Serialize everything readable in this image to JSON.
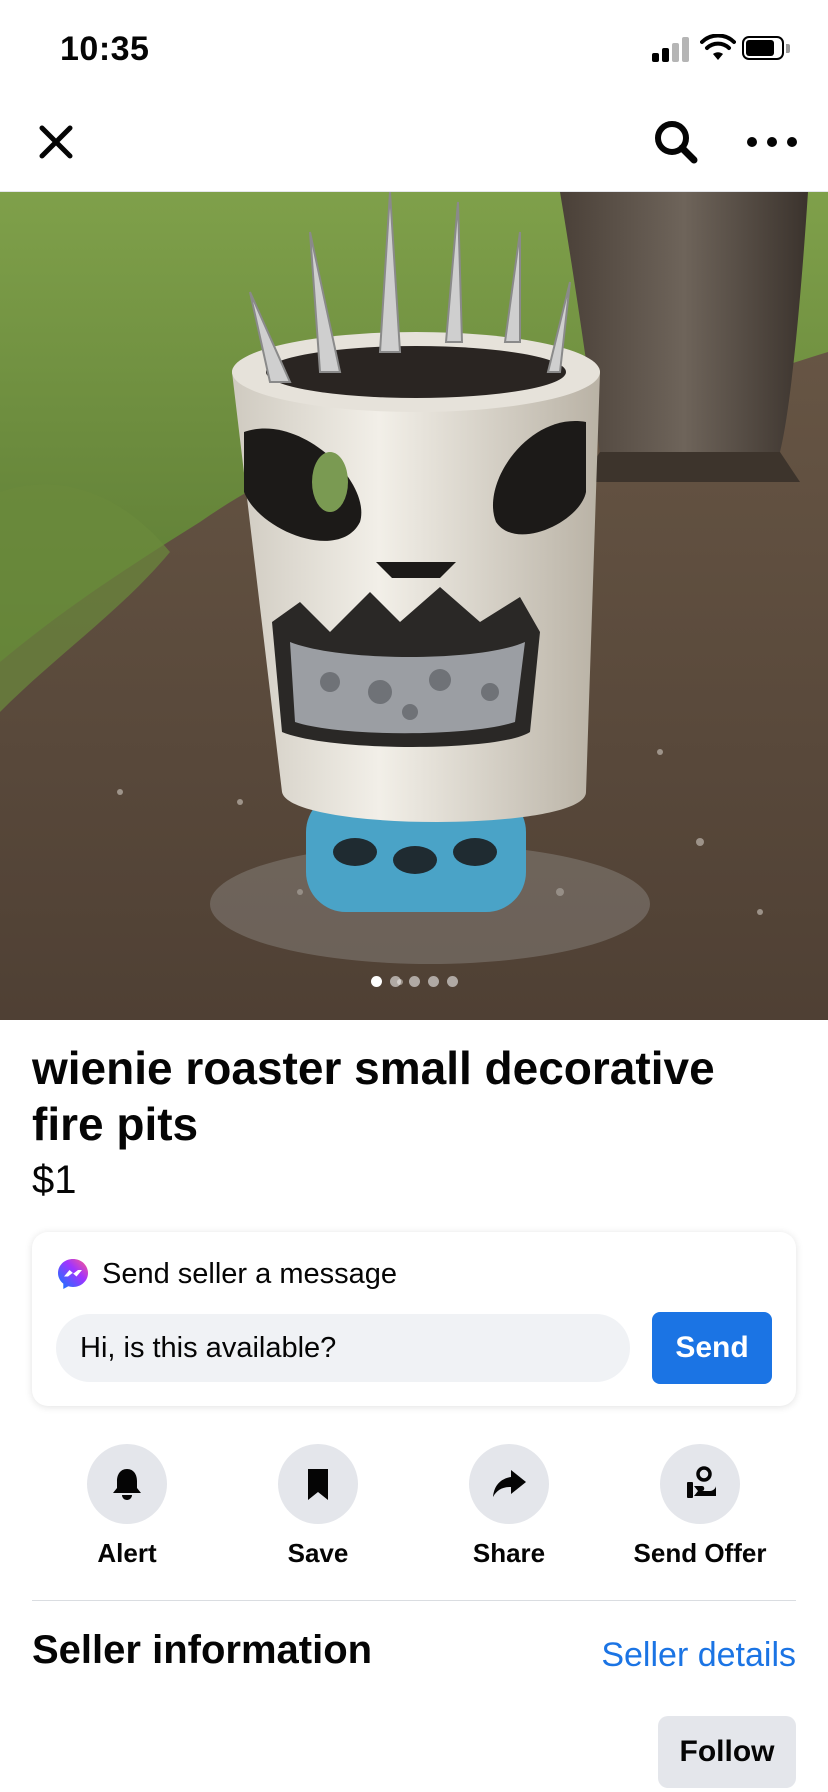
{
  "status_bar": {
    "time": "10:35"
  },
  "nav": {
    "close_icon": "close-icon",
    "search_icon": "search-icon",
    "more_icon": "more-icon"
  },
  "listing": {
    "title": "wienie roaster small decorative fire pits",
    "price": "$1",
    "photo_count": 5,
    "active_photo_index": 0
  },
  "message_box": {
    "header": "Send seller a message",
    "input_value": "Hi, is this available?",
    "send_label": "Send"
  },
  "actions": [
    {
      "label": "Alert",
      "icon": "bell-icon"
    },
    {
      "label": "Save",
      "icon": "bookmark-icon"
    },
    {
      "label": "Share",
      "icon": "share-icon"
    },
    {
      "label": "Send Offer",
      "icon": "send-offer-icon"
    }
  ],
  "seller": {
    "section_title": "Seller information",
    "details_link": "Seller details",
    "follow_label": "Follow"
  },
  "colors": {
    "accent": "#1b74e4",
    "button_gray": "#e4e6eb",
    "input_bg": "#f0f2f5"
  }
}
